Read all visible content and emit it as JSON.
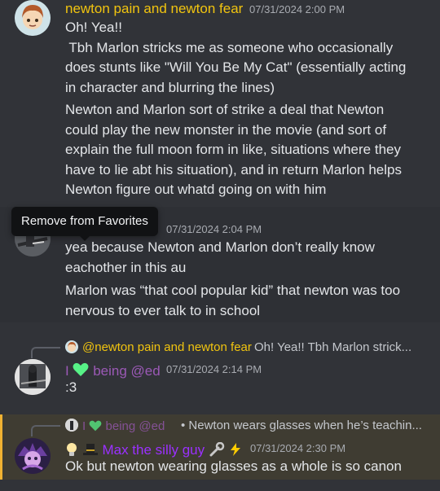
{
  "messages": [
    {
      "author": "newton pain and newton fear",
      "timestamp": "07/31/2024 2:00 PM",
      "lines": [
        "Oh! Yea!!",
        " Tbh Marlon stricks me as someone who occasionally",
        "does stunts like \"Will You Be My Cat\" (essentially acting",
        "in character and blurring the lines)"
      ],
      "followup_lines": [
        "Newton and Marlon sort of strike a deal that Newton",
        "could play the new monster in the movie (and sort of",
        "explain the full moon form in like, situations where they",
        "have to lie abt his situation), and in return Marlon helps",
        "Newton figure out whatd going on with him"
      ]
    },
    {
      "timestamp": "07/31/2024 2:04 PM",
      "lines": [
        "yea because Newton and Marlon don’t really know",
        "eachother in this au"
      ],
      "followup_lines": [
        "Marlon was “that cool popular kid” that newton was too",
        "nervous to ever talk to in school"
      ]
    },
    {
      "reply_author": "@newton pain and newton fear",
      "reply_snippet": "Oh! Yea!!  Tbh Marlon strick...",
      "author_prefix": "I",
      "author_suffix": "being @ed",
      "timestamp": "07/31/2024 2:14 PM",
      "text": ":3"
    },
    {
      "reply_author_prefix": "I",
      "reply_author_suffix": "being @ed",
      "reply_snippet": "• Newton wears glasses when he’s teachin...",
      "author": "Max the silly guy",
      "timestamp": "07/31/2024 2:30 PM",
      "text": "Ok but newton wearing glasses as a whole is so canon"
    }
  ],
  "tooltip": "Remove from Favorites",
  "colors": {
    "background": "#313338",
    "hover_background": "#2e3035",
    "highlight_background": "#3f3c32",
    "highlight_bar": "#f0b232",
    "newton_name": "#f1c40f",
    "ed_name": "#9b59b6",
    "max_name": "#9b30ff",
    "heart": "#57f287"
  },
  "icons": [
    "newton-avatar",
    "marlon-avatar",
    "ed-avatar",
    "max-avatar",
    "green-heart-icon",
    "lightbulb-icon",
    "top-hat-icon",
    "wrench-icon",
    "lightning-icon"
  ]
}
